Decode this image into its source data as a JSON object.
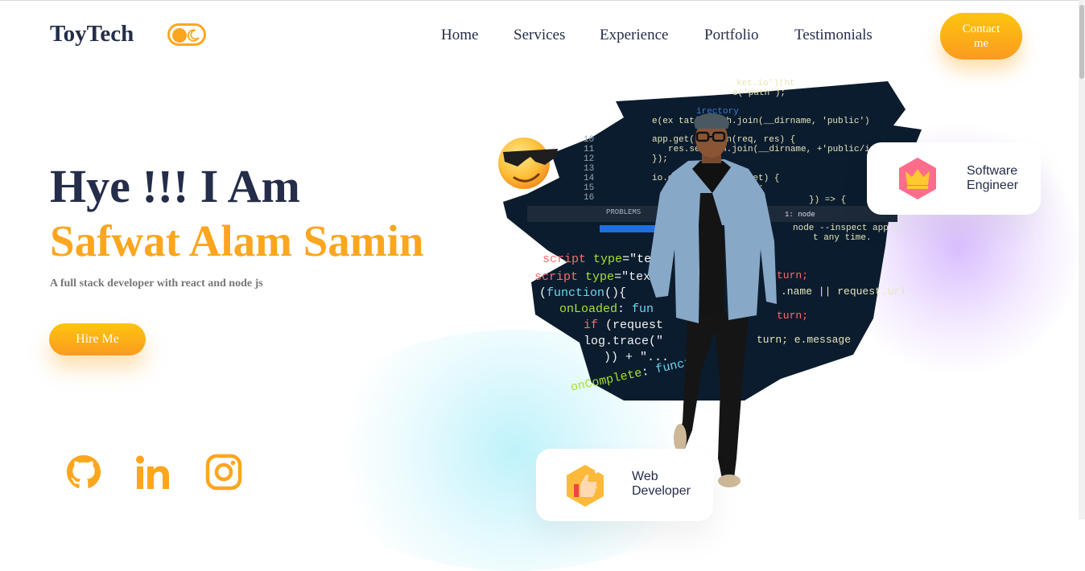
{
  "header": {
    "logo": "ToyTech",
    "nav": [
      "Home",
      "Services",
      "Experience",
      "Portfolio",
      "Testimonials"
    ],
    "contact_button": "Contact me"
  },
  "hero": {
    "greeting": "Hye !!! I Am",
    "name": "Safwat Alam Samin",
    "subtitle": "A full stack developer with react and node js",
    "hire_button": "Hire Me"
  },
  "cards": {
    "software": {
      "line1": "Software",
      "line2": "Engineer"
    },
    "web": {
      "line1": "Web",
      "line2": "Developer"
    }
  },
  "social": [
    "github-icon",
    "linkedin-icon",
    "instagram-icon"
  ],
  "colors": {
    "accent": "#fca61f",
    "text": "#242d4a",
    "gray": "#777777"
  }
}
